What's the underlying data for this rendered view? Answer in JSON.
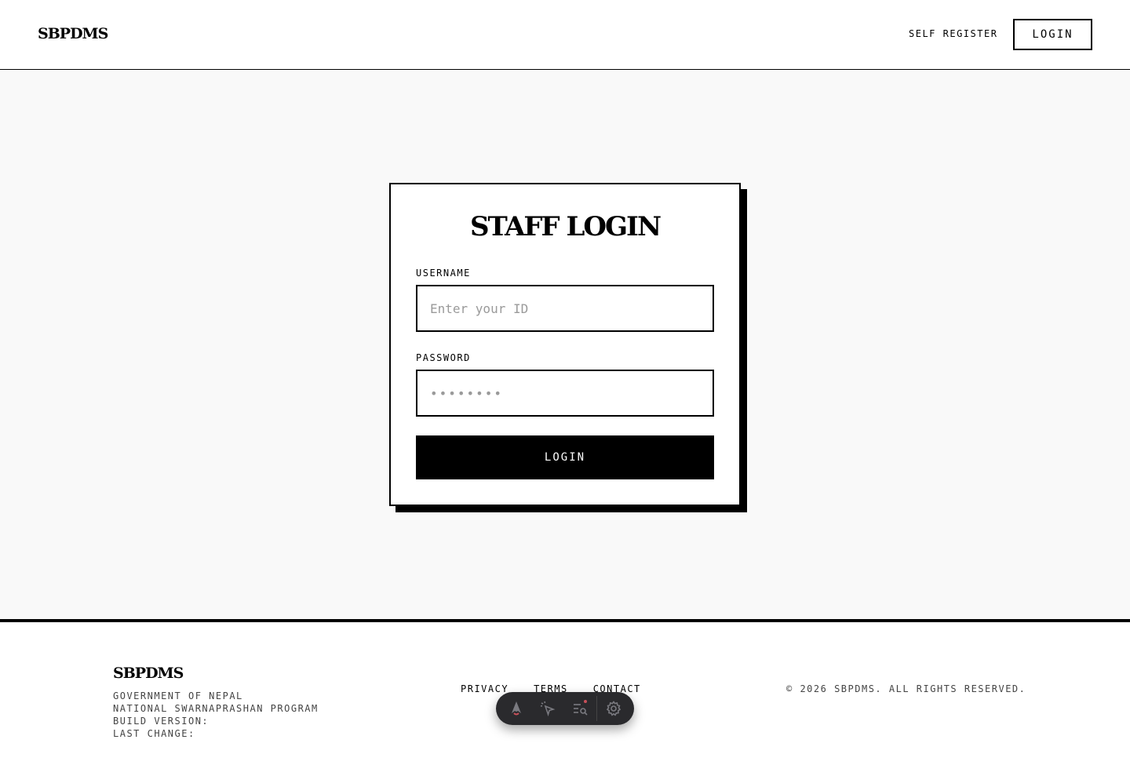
{
  "header": {
    "brand": "SBPDMS",
    "self_register_label": "SELF REGISTER",
    "login_label": "LOGIN"
  },
  "login_card": {
    "title": "STAFF LOGIN",
    "username_label": "USERNAME",
    "username_placeholder": "Enter your ID",
    "password_label": "PASSWORD",
    "password_placeholder": "••••••••",
    "submit_label": "LOGIN"
  },
  "footer": {
    "brand": "SBPDMS",
    "info_lines": [
      "GOVERNMENT OF NEPAL",
      "NATIONAL SWARNAPRASHAN PROGRAM",
      "BUILD VERSION:",
      "LAST CHANGE:"
    ],
    "links": [
      "PRIVACY",
      "TERMS",
      "CONTACT"
    ],
    "copyright": "© 2026 SBPDMS. ALL RIGHTS RESERVED."
  },
  "toolbar": {
    "icons": [
      "astro-logo-icon",
      "cursor-inspect-icon",
      "audit-search-icon",
      "gear-icon"
    ],
    "notification_color": "#c8505a"
  },
  "colors": {
    "text": "#000000",
    "background": "#f9f9f9",
    "surface": "#ffffff",
    "toolbar": "#2a2a2d"
  }
}
